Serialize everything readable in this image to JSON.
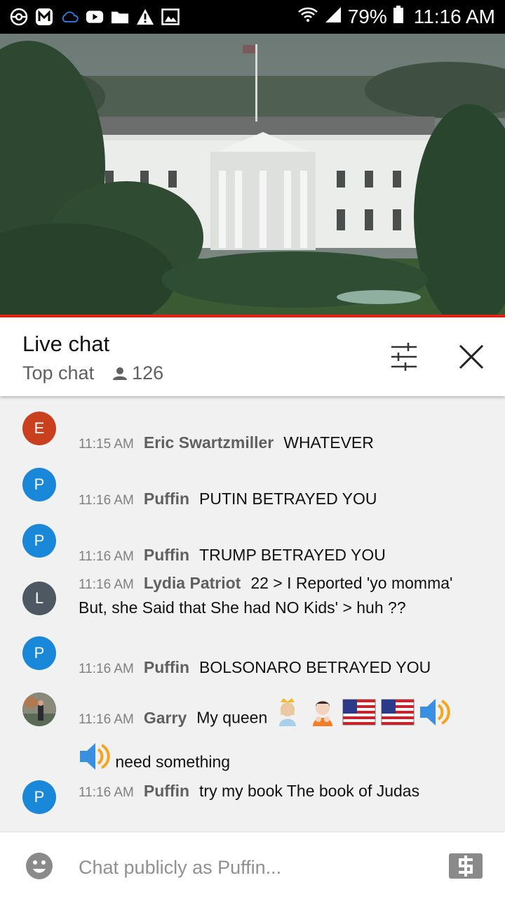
{
  "status_bar": {
    "battery_percent": "79%",
    "time": "11:16 AM",
    "left_icons": [
      "pokeball-icon",
      "m-app-icon",
      "cloud-icon",
      "youtube-icon",
      "folder-icon",
      "warning-icon",
      "image-icon"
    ],
    "right_icons": [
      "wifi-icon",
      "signal-icon",
      "battery-icon"
    ]
  },
  "video": {
    "scene": "white-house"
  },
  "chat_header": {
    "title": "Live chat",
    "mode": "Top chat",
    "viewer_count": "126"
  },
  "messages": [
    {
      "avatar_letter": "E",
      "avatar_color": "#c8401e",
      "time": "11:15 AM",
      "author": "Eric Swartzmiller",
      "text": "WHATEVER"
    },
    {
      "avatar_letter": "P",
      "avatar_color": "#1a88d8",
      "time": "11:16 AM",
      "author": "Puffin",
      "text": "PUTIN BETRAYED YOU"
    },
    {
      "avatar_letter": "P",
      "avatar_color": "#1a88d8",
      "time": "11:16 AM",
      "author": "Puffin",
      "text": "TRUMP BETRAYED YOU"
    },
    {
      "avatar_letter": "L",
      "avatar_color": "#4d5863",
      "time": "11:16 AM",
      "author": "Lydia Patriot",
      "text": "22 > I Reported 'yo momma' But, she Said that She had NO Kids' > huh ??"
    },
    {
      "avatar_letter": "P",
      "avatar_color": "#1a88d8",
      "time": "11:16 AM",
      "author": "Puffin",
      "text": "BOLSONARO BETRAYED YOU"
    },
    {
      "avatar_letter": "",
      "avatar_color": "#7a7a70",
      "time": "11:16 AM",
      "author": "Garry",
      "text": "My queen",
      "text2": "need something",
      "emojis": [
        "princess-emoji",
        "person-pouting-emoji",
        "us-flag-emoji",
        "us-flag-emoji",
        "speaker-emoji"
      ],
      "emojis2": [
        "speaker-emoji"
      ]
    },
    {
      "avatar_letter": "P",
      "avatar_color": "#1a88d8",
      "time": "11:16 AM",
      "author": "Puffin",
      "text": "try my book The book of Judas"
    }
  ],
  "input": {
    "placeholder": "Chat publicly as Puffin..."
  },
  "colors": {
    "progress": "#e62117",
    "background": "#f1f1f1"
  }
}
